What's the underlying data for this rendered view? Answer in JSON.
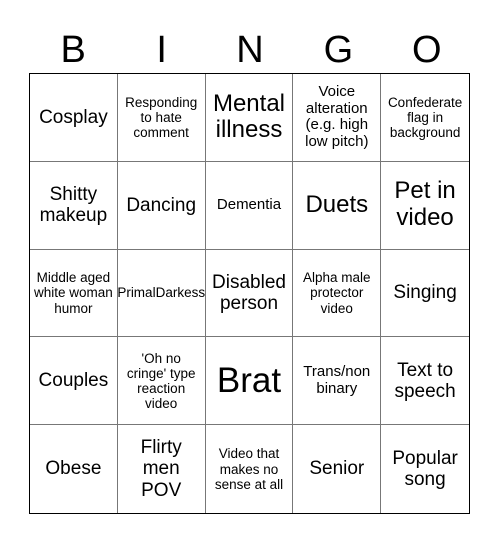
{
  "header": {
    "letters": [
      "B",
      "I",
      "N",
      "G",
      "O"
    ]
  },
  "cells": [
    {
      "text": "Cosplay",
      "size": "s3"
    },
    {
      "text": "Responding to hate comment",
      "size": "s1"
    },
    {
      "text": "Mental illness",
      "size": "s4"
    },
    {
      "text": "Voice alteration (e.g. high low pitch)",
      "size": "s2"
    },
    {
      "text": "Confederate flag in background",
      "size": "s1"
    },
    {
      "text": "Shitty makeup",
      "size": "s3"
    },
    {
      "text": "Dancing",
      "size": "s3"
    },
    {
      "text": "Dementia",
      "size": "s2"
    },
    {
      "text": "Duets",
      "size": "s4"
    },
    {
      "text": "Pet in video",
      "size": "s4"
    },
    {
      "text": "Middle aged white woman humor",
      "size": "s1"
    },
    {
      "text": "PrimalDarkess",
      "size": "s1"
    },
    {
      "text": "Disabled person",
      "size": "s3"
    },
    {
      "text": "Alpha male protector video",
      "size": "s1"
    },
    {
      "text": "Singing",
      "size": "s3"
    },
    {
      "text": "Couples",
      "size": "s3"
    },
    {
      "text": "'Oh no cringe' type reaction video",
      "size": "s1"
    },
    {
      "text": "Brat",
      "size": "s5"
    },
    {
      "text": "Trans/non binary",
      "size": "s2"
    },
    {
      "text": "Text to speech",
      "size": "s3"
    },
    {
      "text": "Obese",
      "size": "s3"
    },
    {
      "text": "Flirty men POV",
      "size": "s3"
    },
    {
      "text": "Video that makes no sense at all",
      "size": "s1"
    },
    {
      "text": "Senior",
      "size": "s3"
    },
    {
      "text": "Popular song",
      "size": "s3"
    }
  ]
}
